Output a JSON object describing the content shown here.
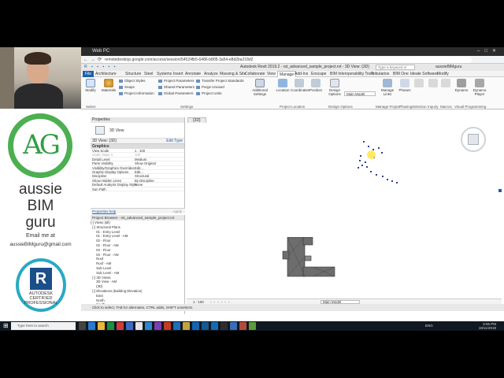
{
  "presenter": {
    "logo_letters": "AG",
    "brand_line1": "aussie",
    "brand_line2": "BIM",
    "brand_line3": "guru",
    "email_label": "Email me at",
    "email": "aussieBIMguru@gmail.com",
    "cert_brand": "AUTODESK",
    "cert_sub": "CERTIFIED PROFESSIONAL",
    "cert_letter": "R"
  },
  "browser": {
    "window_title": "Web PC",
    "url": "remotedesktop.google.com/access/session/54524fb5-6486-b805-3a54-e8d2ba218d2"
  },
  "revit": {
    "title": "Autodesk Revit 2019.2 - rst_advanced_sample_project.rvt - 3D View: {3D}",
    "search_placeholder": "Type a keyword or phrase",
    "user": "aussieBIMguru",
    "tabs": [
      "File",
      "Architecture",
      "Structure",
      "Steel",
      "Systems",
      "Insert",
      "Annotate",
      "Analyze",
      "Massing & Site",
      "Collaborate",
      "View",
      "Manage",
      "Add-Ins",
      "Enscape",
      "BIM Interoperability Tools",
      "Tributarios",
      "BIM One",
      "Ideate Software",
      "Modify"
    ],
    "active_tab": "Manage",
    "ribbon": {
      "styles": "Styles",
      "materials": "Materials",
      "object_styles": "Object Styles",
      "snaps": "Snaps",
      "project_information": "Project Information",
      "project_parameters": "Project Parameters",
      "shared_parameters": "Shared Parameters",
      "global_parameters": "Global Parameters",
      "transfer_standards": "Transfer Project Standards",
      "purge_unused": "Purge Unused",
      "project_units": "Project Units",
      "additional_settings": "Additional Settings",
      "settings_group": "Settings",
      "location": "Location",
      "coordinates": "Coordinates",
      "position": "Position",
      "project_location_group": "Project Location",
      "design_options": "Design Options",
      "main_model": "Main Model",
      "design_options_group": "Design Options",
      "manage_links": "Manage Links",
      "manage_project_group": "Manage Project",
      "phases": "Phases",
      "phasing_group": "Phasing",
      "selection_group": "Selection",
      "inquiry_group": "Inquiry",
      "macros_group": "Macros",
      "dynamo": "Dynamo",
      "dynamo_player": "Dynamo Player",
      "visual_programming_group": "Visual Programming"
    },
    "modify_label": "Modify",
    "select_label": "Select"
  },
  "properties": {
    "header": "Properties",
    "type_name": "3D View",
    "selector": "3D View: {3D}",
    "edit_type": "Edit Type",
    "category": "Graphics",
    "rows": [
      {
        "k": "View Scale",
        "v": "1 : 100"
      },
      {
        "k": "Scale Value    1:",
        "v": "100"
      },
      {
        "k": "Detail Level",
        "v": "Medium"
      },
      {
        "k": "Parts Visibility",
        "v": "Show Original"
      },
      {
        "k": "Visibility/Graphics Overrides",
        "v": "Edit..."
      },
      {
        "k": "Graphic Display Options",
        "v": "Edit..."
      },
      {
        "k": "Discipline",
        "v": "Structural"
      },
      {
        "k": "Show Hidden Lines",
        "v": "By Discipline"
      },
      {
        "k": "Default Analysis Display Style",
        "v": "None"
      },
      {
        "k": "Sun Path",
        "v": ""
      }
    ],
    "help_link": "Properties help",
    "apply": "Apply"
  },
  "project_browser": {
    "header": "Project Browser - rst_advanced_sample_project.rvt",
    "rows": [
      "[-] Views (all)",
      "  [-] Structural Plans",
      "      01 - Entry Level",
      "      01 - Entry Level - AM",
      "      02 - Floor",
      "      02 - Floor - AM",
      "      03 - Floor",
      "      03 - Floor - AM",
      "      Roof",
      "      Roof - AM",
      "      Sub Level",
      "      Sub Level - AM",
      "  [-] 3D Views",
      "      3D View - AM",
      "      {3D}",
      "  [-] Elevations (Building Elevation)",
      "      East",
      "      North",
      "      South"
    ]
  },
  "view": {
    "tab_label": "{3D}",
    "scale": "1 : 100",
    "main_model": "Main Model"
  },
  "status_bar": "Click to select, TAB for alternates, CTRL adds, SHIFT unselects.",
  "taskbar": {
    "search": "Type here to search",
    "time": "8:55 PM",
    "date": "18/11/2019",
    "lang": "ENG"
  }
}
